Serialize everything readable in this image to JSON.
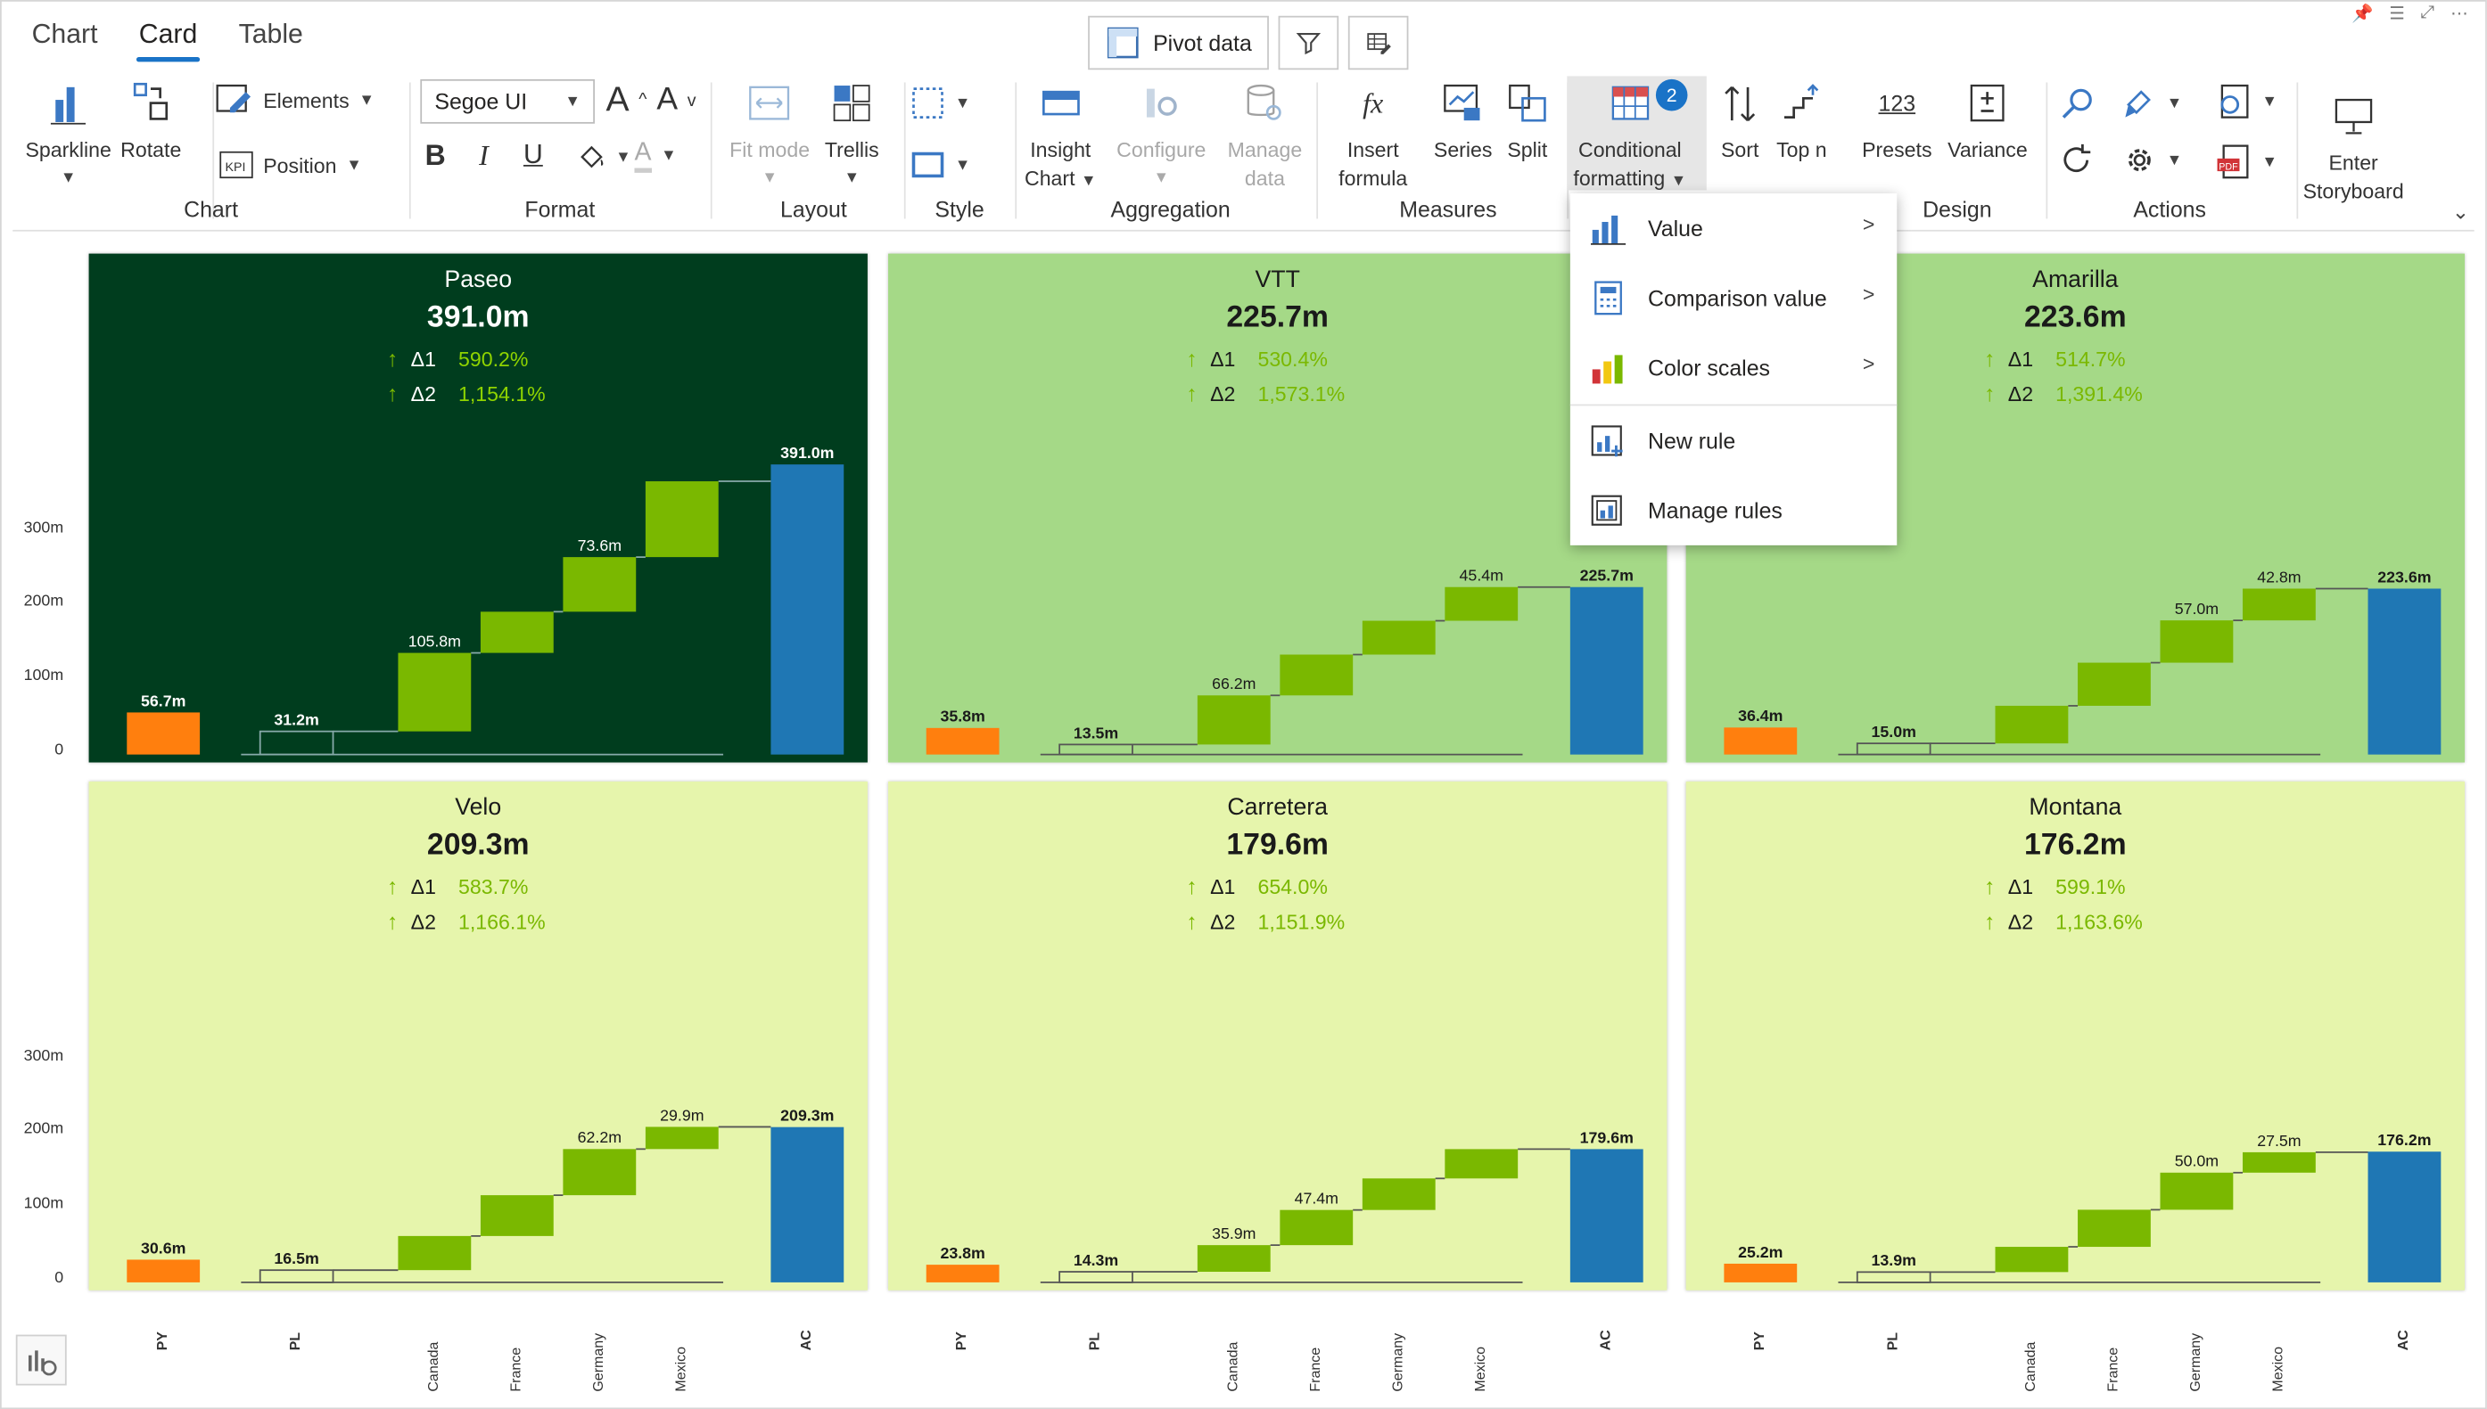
{
  "tabs": [
    "Chart",
    "Card",
    "Table"
  ],
  "top_buttons": {
    "pivot": "Pivot data"
  },
  "ribbon": {
    "sparkline": "Sparkline",
    "rotate": "Rotate",
    "elements": "Elements",
    "position": "Position",
    "chart_group": "Chart",
    "font": "Segoe UI",
    "format_group": "Format",
    "fit_mode": "Fit mode",
    "trellis": "Trellis",
    "layout_group": "Layout",
    "style_group": "Style",
    "insight_chart_1": "Insight",
    "insight_chart_2": "Chart",
    "configure": "Configure",
    "manage_1": "Manage",
    "manage_2": "data",
    "aggregation_group": "Aggregation",
    "insert_1": "Insert",
    "insert_2": "formula",
    "series": "Series",
    "split": "Split",
    "measures_group": "Measures",
    "cf_1": "Conditional",
    "cf_2": "formatting",
    "cf_badge": "2",
    "sort": "Sort",
    "topn": "Top n",
    "presets": "Presets",
    "variance": "Variance",
    "design_group": "Design",
    "actions_group": "Actions",
    "storyboard_1": "Enter",
    "storyboard_2": "Storyboard"
  },
  "menu": {
    "items": [
      "Value",
      "Comparison value",
      "Color scales",
      "New rule",
      "Manage rules"
    ]
  },
  "colors": {
    "dark_card": "#003d1e",
    "mid_card": "#a5d987",
    "light_card": "#e6f5ac",
    "green": "#7ab800",
    "orange": "#ff7f0e",
    "blue": "#1f77b4"
  },
  "cards": [
    {
      "name": "Paseo",
      "value": "391.0m",
      "d1_label": "Δ1",
      "d1": "590.2%",
      "d2_label": "Δ2",
      "d2": "1,154.1%"
    },
    {
      "name": "VTT",
      "value": "225.7m",
      "d1_label": "Δ1",
      "d1": "530.4%",
      "d2_label": "Δ2",
      "d2": "1,573.1%"
    },
    {
      "name": "Amarilla",
      "value": "223.6m",
      "d1_label": "Δ1",
      "d1": "514.7%",
      "d2_label": "Δ2",
      "d2": "1,391.4%"
    },
    {
      "name": "Velo",
      "value": "209.3m",
      "d1_label": "Δ1",
      "d1": "583.7%",
      "d2_label": "Δ2",
      "d2": "1,166.1%"
    },
    {
      "name": "Carretera",
      "value": "179.6m",
      "d1_label": "Δ1",
      "d1": "654.0%",
      "d2_label": "Δ2",
      "d2": "1,151.9%"
    },
    {
      "name": "Montana",
      "value": "176.2m",
      "d1_label": "Δ1",
      "d1": "599.1%",
      "d2_label": "Δ2",
      "d2": "1,163.6%"
    }
  ],
  "chart_data": [
    {
      "type": "bar",
      "title": "Paseo",
      "categories": [
        "PY",
        "PL",
        "Canada",
        "France",
        "Germany",
        "Mexico",
        "AC"
      ],
      "values": [
        56.7,
        31.2,
        105.8,
        55.5,
        73.6,
        102.2,
        391.0
      ],
      "labels": [
        "56.7m",
        "31.2m",
        "105.8m",
        "",
        "73.6m",
        "",
        "391.0m"
      ],
      "ylim": [
        0,
        391
      ],
      "yticks": [
        "0",
        "100m",
        "200m",
        "300m"
      ]
    },
    {
      "type": "bar",
      "title": "VTT",
      "categories": [
        "PY",
        "PL",
        "Canada",
        "France",
        "Germany",
        "Mexico",
        "AC"
      ],
      "values": [
        35.8,
        13.5,
        66.2,
        55.0,
        45.6,
        45.4,
        225.7
      ],
      "labels": [
        "35.8m",
        "13.5m",
        "66.2m",
        "",
        "",
        "45.4m",
        "225.7m"
      ],
      "ylim": [
        0,
        391
      ]
    },
    {
      "type": "bar",
      "title": "Amarilla",
      "categories": [
        "PY",
        "PL",
        "Canada",
        "France",
        "Germany",
        "Mexico",
        "AC"
      ],
      "values": [
        36.4,
        15.0,
        50.7,
        58.1,
        57.0,
        42.8,
        223.6
      ],
      "labels": [
        "36.4m",
        "15.0m",
        "",
        "",
        "57.0m",
        "42.8m",
        "223.6m"
      ],
      "ylim": [
        0,
        391
      ]
    },
    {
      "type": "bar",
      "title": "Velo",
      "categories": [
        "PY",
        "PL",
        "Canada",
        "France",
        "Germany",
        "Mexico",
        "AC"
      ],
      "values": [
        30.6,
        16.5,
        46.0,
        55.0,
        62.2,
        29.9,
        209.3
      ],
      "labels": [
        "30.6m",
        "16.5m",
        "",
        "",
        "62.2m",
        "29.9m",
        "209.3m"
      ],
      "ylim": [
        0,
        391
      ],
      "yticks": [
        "0",
        "100m",
        "200m",
        "300m"
      ]
    },
    {
      "type": "bar",
      "title": "Carretera",
      "categories": [
        "PY",
        "PL",
        "Canada",
        "France",
        "Germany",
        "Mexico",
        "AC"
      ],
      "values": [
        23.8,
        14.3,
        35.9,
        47.4,
        42.5,
        39.5,
        179.6
      ],
      "labels": [
        "23.8m",
        "14.3m",
        "35.9m",
        "47.4m",
        "",
        "",
        " 179.6m"
      ],
      "ylim": [
        0,
        391
      ]
    },
    {
      "type": "bar",
      "title": "Montana",
      "categories": [
        "PY",
        "PL",
        "Canada",
        "France",
        "Germany",
        "Mexico",
        "AC"
      ],
      "values": [
        25.2,
        13.9,
        34.0,
        50.0,
        50.0,
        27.5,
        176.2
      ],
      "labels": [
        "25.2m",
        "13.9m",
        "",
        "",
        "50.0m",
        "27.5m",
        "176.2m"
      ],
      "ylim": [
        0,
        391
      ]
    }
  ]
}
